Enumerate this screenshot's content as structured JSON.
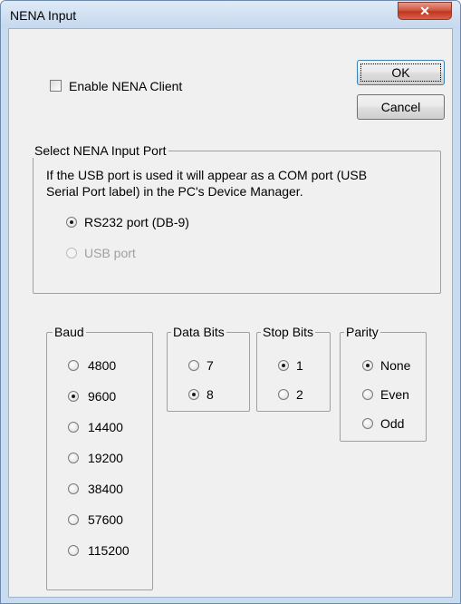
{
  "window": {
    "title": "NENA Input",
    "close_glyph": "✕"
  },
  "enable_client": {
    "label": "Enable NENA Client",
    "checked": false
  },
  "buttons": {
    "ok": "OK",
    "cancel": "Cancel"
  },
  "input_port": {
    "title": "Select NENA Input Port",
    "description_line1": "If the USB port is used it will appear as a  COM port (USB",
    "description_line2": "Serial Port label) in the PC's Device Manager.",
    "options": [
      {
        "label": "RS232 port (DB-9)",
        "checked": true,
        "enabled": true
      },
      {
        "label": "USB port",
        "checked": false,
        "enabled": false
      }
    ]
  },
  "baud": {
    "title": "Baud",
    "selected": "9600",
    "options": [
      "4800",
      "9600",
      "14400",
      "19200",
      "38400",
      "57600",
      "115200"
    ]
  },
  "data_bits": {
    "title": "Data Bits",
    "selected": "8",
    "options": [
      "7",
      "8"
    ]
  },
  "stop_bits": {
    "title": "Stop Bits",
    "selected": "1",
    "options": [
      "1",
      "2"
    ]
  },
  "parity": {
    "title": "Parity",
    "selected": "None",
    "options": [
      "None",
      "Even",
      "Odd"
    ]
  }
}
